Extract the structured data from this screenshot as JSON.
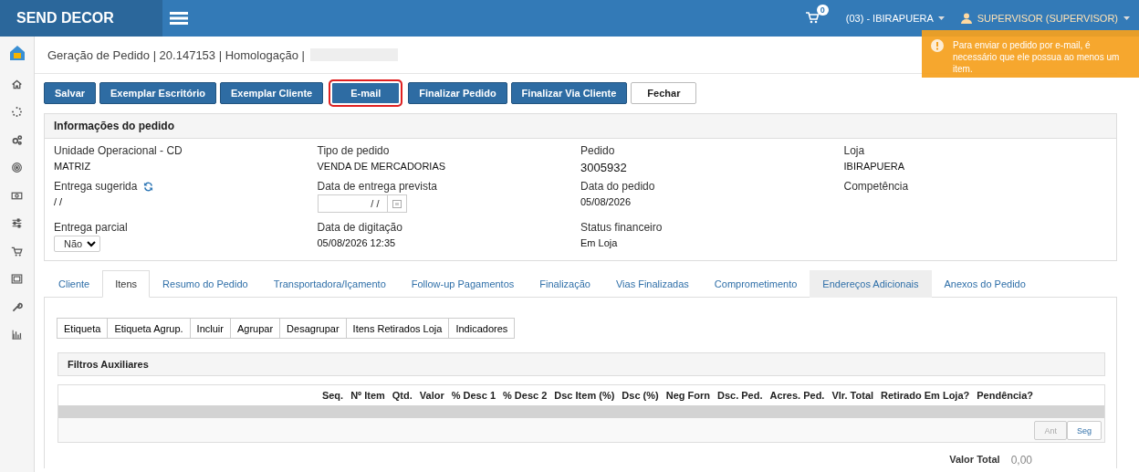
{
  "header": {
    "brand": "SEND DECOR",
    "cart_count": "0",
    "store": "(03) - IBIRAPUERA",
    "user": "SUPERVISOR (SUPERVISOR)"
  },
  "toast": {
    "message": "Para enviar o pedido por e-mail, é necessário que ele possua ao menos um item."
  },
  "breadcrumb": "Geração de Pedido | 20.147153 | Homologação |",
  "actions": [
    {
      "label": "Salvar",
      "kind": "primary",
      "highlighted": false
    },
    {
      "label": "Exemplar Escritório",
      "kind": "primary",
      "highlighted": false
    },
    {
      "label": "Exemplar Cliente",
      "kind": "primary",
      "highlighted": false
    },
    {
      "label": "E-mail",
      "kind": "primary",
      "highlighted": true
    },
    {
      "label": "Finalizar Pedido",
      "kind": "primary",
      "highlighted": false
    },
    {
      "label": "Finalizar Via Cliente",
      "kind": "primary",
      "highlighted": false
    },
    {
      "label": "Fechar",
      "kind": "default",
      "highlighted": false
    }
  ],
  "order_info": {
    "title": "Informações do pedido",
    "fields": [
      {
        "label": "Unidade Operacional - CD",
        "kind": "text",
        "value": "MATRIZ"
      },
      {
        "label": "Tipo de pedido",
        "kind": "text",
        "value": "VENDA DE MERCADORIAS"
      },
      {
        "label": "Pedido",
        "kind": "big",
        "value": "3005932"
      },
      {
        "label": "Loja",
        "kind": "text",
        "value": "IBIRAPUERA"
      },
      {
        "label": "Entrega sugerida",
        "kind": "refresh",
        "value": "/ /"
      },
      {
        "label": "Data de entrega prevista",
        "kind": "date",
        "value": "/ /"
      },
      {
        "label": "Data do pedido",
        "kind": "text",
        "value": "05/08/2026"
      },
      {
        "label": "Competência",
        "kind": "text"
      },
      {
        "label": "Entrega parcial",
        "kind": "select",
        "value": "Não"
      },
      {
        "label": "Data de digitação",
        "kind": "text",
        "value": "05/08/2026 12:35"
      },
      {
        "label": "Status financeiro",
        "kind": "text",
        "value": "Em Loja"
      }
    ]
  },
  "tabs": [
    {
      "label": "Cliente",
      "selected": false,
      "hovered": false
    },
    {
      "label": "Itens",
      "selected": true,
      "hovered": false
    },
    {
      "label": "Resumo do Pedido",
      "selected": false,
      "hovered": false
    },
    {
      "label": "Transportadora/Içamento",
      "selected": false,
      "hovered": false
    },
    {
      "label": "Follow-up Pagamentos",
      "selected": false,
      "hovered": false
    },
    {
      "label": "Finalização",
      "selected": false,
      "hovered": false
    },
    {
      "label": "Vias Finalizadas",
      "selected": false,
      "hovered": false
    },
    {
      "label": "Comprometimento",
      "selected": false,
      "hovered": false
    },
    {
      "label": "Endereços Adicionais",
      "selected": false,
      "hovered": true
    },
    {
      "label": "Anexos do Pedido",
      "selected": false,
      "hovered": false
    }
  ],
  "item_toolbar": [
    "Etiqueta",
    "Etiqueta Agrup.",
    "Incluir",
    "Agrupar",
    "Desagrupar",
    "Itens Retirados Loja",
    "Indicadores"
  ],
  "filters": {
    "title": "Filtros Auxiliares"
  },
  "table": {
    "columns": [
      "Seq.",
      "Nº Item",
      "Qtd.",
      "Valor",
      "% Desc 1",
      "% Desc 2",
      "Dsc Item (%)",
      "Dsc (%)",
      "Neg Forn",
      "Dsc. Ped.",
      "Acres. Ped.",
      "Vlr. Total",
      "Retirado Em Loja?",
      "Pendência?"
    ]
  },
  "pager": [
    {
      "label": "Ant",
      "disabled": true
    },
    {
      "label": "Seg",
      "disabled": false
    }
  ],
  "total": {
    "label": "Valor Total",
    "value": "0,00"
  }
}
